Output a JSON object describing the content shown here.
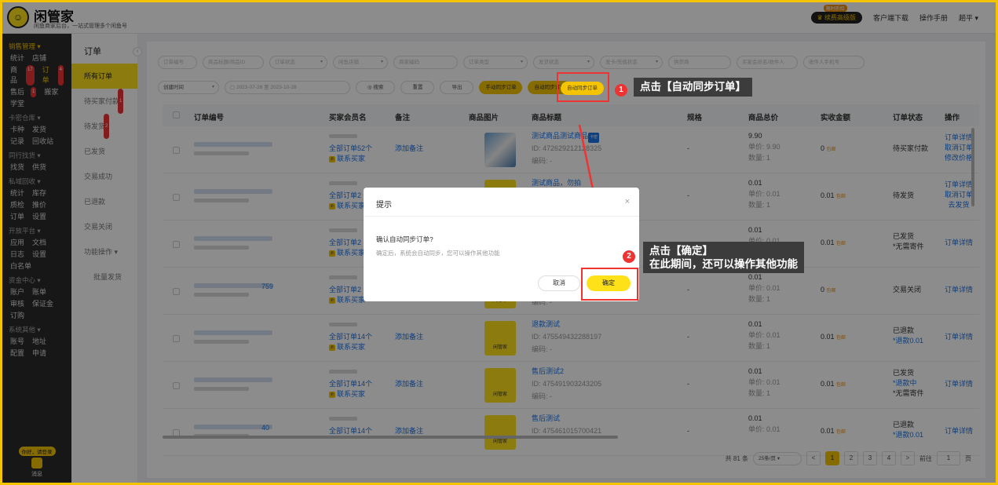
{
  "header": {
    "brand": "闲管家",
    "subtitle": "闲鱼商家后台，一站式管理多个闲鱼号",
    "upgrade_label": "续费高级版",
    "upgrade_tag": "限时折扣",
    "download": "客户端下载",
    "manual": "操作手册",
    "user": "趟平 ▾"
  },
  "leftnav": [
    {
      "section": "销售管理 ▾",
      "rows": [
        [
          "统计",
          "店铺"
        ],
        [
          "商品",
          "订单"
        ],
        [
          "售后",
          "搬家"
        ],
        [
          "学堂"
        ]
      ]
    },
    {
      "section": "卡密仓库 ▾",
      "rows": [
        [
          "卡种",
          "发货"
        ],
        [
          "记录",
          "回收站"
        ]
      ]
    },
    {
      "section": "同行找货 ▾",
      "rows": [
        [
          "找货",
          "供货"
        ]
      ]
    },
    {
      "section": "私域回收 ▾",
      "rows": [
        [
          "统计",
          "库存"
        ],
        [
          "质检",
          "推价"
        ],
        [
          "订单",
          "设置"
        ]
      ]
    },
    {
      "section": "开放平台 ▾",
      "rows": [
        [
          "应用",
          "文档"
        ],
        [
          "日志",
          "设置"
        ],
        [
          "白名单"
        ]
      ]
    },
    {
      "section": "资金中心 ▾",
      "rows": [
        [
          "账户",
          "账单"
        ],
        [
          "审核",
          "保证金"
        ],
        [
          "订购"
        ]
      ]
    },
    {
      "section": "系统其他 ▾",
      "rows": [
        [
          "账号",
          "地址"
        ],
        [
          "配置",
          "申请"
        ]
      ]
    }
  ],
  "nav_badges": {
    "goods": "17",
    "orders": "4",
    "aftersale": "1"
  },
  "nav_msg": {
    "pill": "你好，请登录",
    "label": "消息"
  },
  "subnav": {
    "title": "订单",
    "items": [
      "所有订单",
      "待买家付款",
      "待发货",
      "已发货",
      "交易成功",
      "已退款",
      "交易关闭",
      "功能操作 ▾",
      "批量发货"
    ],
    "badges": {
      "pending_pay": "1",
      "pending_ship": "2"
    }
  },
  "filters": {
    "row1": [
      "订单编号",
      "商品标题/商品ID",
      "订单状态",
      "闲鱼店铺",
      "商家编码",
      "订单类型",
      "发货状态",
      "发卡/充值状态",
      "供货商",
      "买家会员名/收件人",
      "收件人手机号"
    ],
    "row2": {
      "time_type": "创建时间",
      "date_from": "2023-07-28",
      "date_sep": "至",
      "date_to": "2023-10-28",
      "search": "◎ 搜索",
      "reset": "重置",
      "export": "导出",
      "manual_sync": "手动同步订单",
      "auto_sync": "自动同步订单"
    }
  },
  "table": {
    "headers": [
      "订单编号",
      "买家会员名",
      "备注",
      "商品图片",
      "商品标题",
      "规格",
      "商品总价",
      "实收金额",
      "订单状态",
      "操作"
    ],
    "rows": [
      {
        "orders_link": "全部订单52个",
        "contact": "联系买家",
        "remark": "添加备注",
        "title": "测试商品测试商品",
        "tag": "卡密",
        "id": "ID: 472629212128325",
        "code": "编码: -",
        "spec": "-",
        "total": "9.90",
        "unit": "单价: 9.90",
        "qty": "数量: 1",
        "paid": "0",
        "ship": "包邮",
        "status": [
          "待买家付款"
        ],
        "ops": [
          "订单详情",
          "取消订单",
          "修改价格"
        ]
      },
      {
        "orders_link": "全部订单2",
        "contact": "联系买家",
        "remark": "",
        "title": "测试商品，勿拍",
        "tag": "",
        "id": "",
        "code": "",
        "spec": "-",
        "total": "0.01",
        "unit": "单价: 0.01",
        "qty": "数量: 1",
        "paid": "0.01",
        "ship": "包邮",
        "status": [
          "待发货"
        ],
        "ops": [
          "订单详情",
          "取消订单",
          "去发货"
        ]
      },
      {
        "orders_link": "全部订单2",
        "contact": "联系买家",
        "remark": "",
        "title": "",
        "tag": "",
        "id": "",
        "code": "",
        "spec": "-",
        "total": "0.01",
        "unit": "单价: 0.01",
        "qty": "数量: 1",
        "paid": "0.01",
        "ship": "包邮",
        "status": [
          "已发货",
          "*无需寄件"
        ],
        "ops": [
          "订单详情"
        ]
      },
      {
        "orders_link": "全部订单2",
        "contact": "联系买家",
        "remark": "",
        "title": "",
        "tag": "",
        "id": "",
        "code": "编码: -",
        "spec": "-",
        "total": "0.01",
        "unit": "单价: 0.01",
        "qty": "数量: 1",
        "paid": "0",
        "ship": "包邮",
        "status": [
          "交易关闭"
        ],
        "ops": [
          "订单详情"
        ],
        "order_tail": "759"
      },
      {
        "orders_link": "全部订单14个",
        "contact": "联系买家",
        "remark": "添加备注",
        "title": "退款测试",
        "tag": "",
        "id": "ID: 475549432288197",
        "code": "编码: -",
        "spec": "-",
        "total": "0.01",
        "unit": "单价: 0.01",
        "qty": "数量: 1",
        "paid": "0.01",
        "ship": "包邮",
        "status": [
          "已退款",
          "*退款0.01"
        ],
        "ops": [
          "订单详情"
        ]
      },
      {
        "orders_link": "全部订单14个",
        "contact": "联系买家",
        "remark": "添加备注",
        "title": "售后测试2",
        "tag": "",
        "id": "ID: 475491903243205",
        "code": "编码: -",
        "spec": "-",
        "total": "0.01",
        "unit": "单价: 0.01",
        "qty": "数量: 1",
        "paid": "0.01",
        "ship": "包邮",
        "status": [
          "已发货",
          "*退款中",
          "*无需寄件"
        ],
        "ops": [
          "订单详情"
        ]
      },
      {
        "orders_link": "全部订单14个",
        "contact": "",
        "remark": "添加备注",
        "title": "售后测试",
        "tag": "",
        "id": "ID: 475461015700421",
        "code": "",
        "spec": "-",
        "total": "0.01",
        "unit": "单价: 0.01",
        "qty": "",
        "paid": "0.01",
        "ship": "包邮",
        "status": [
          "已退款",
          "*退款0.01"
        ],
        "ops": [
          "订单详情"
        ],
        "order_tail": "40"
      }
    ]
  },
  "thumb_label": "闲管家",
  "pager": {
    "total": "共 81 条",
    "size": "25条/页 ▾",
    "prev": "<",
    "pages": [
      "1",
      "2",
      "3",
      "4"
    ],
    "next": ">",
    "goto": "前往",
    "page_input": "1",
    "page_unit": "页"
  },
  "dialog": {
    "title": "提示",
    "close": "×",
    "question": "确认自动同步订单?",
    "desc": "确定后，系统会自动同步，您可以操作其他功能",
    "cancel": "取消",
    "ok": "确定"
  },
  "annotations": {
    "step1_num": "1",
    "step1_text": "点击【自动同步订单】",
    "step2_num": "2",
    "step2_line1": "点击【确定】",
    "step2_line2": "在此期间，还可以操作其他功能"
  },
  "colors": {
    "brand_yellow": "#f5c400",
    "highlight_red": "#e33333",
    "link_blue": "#1a73e8"
  }
}
